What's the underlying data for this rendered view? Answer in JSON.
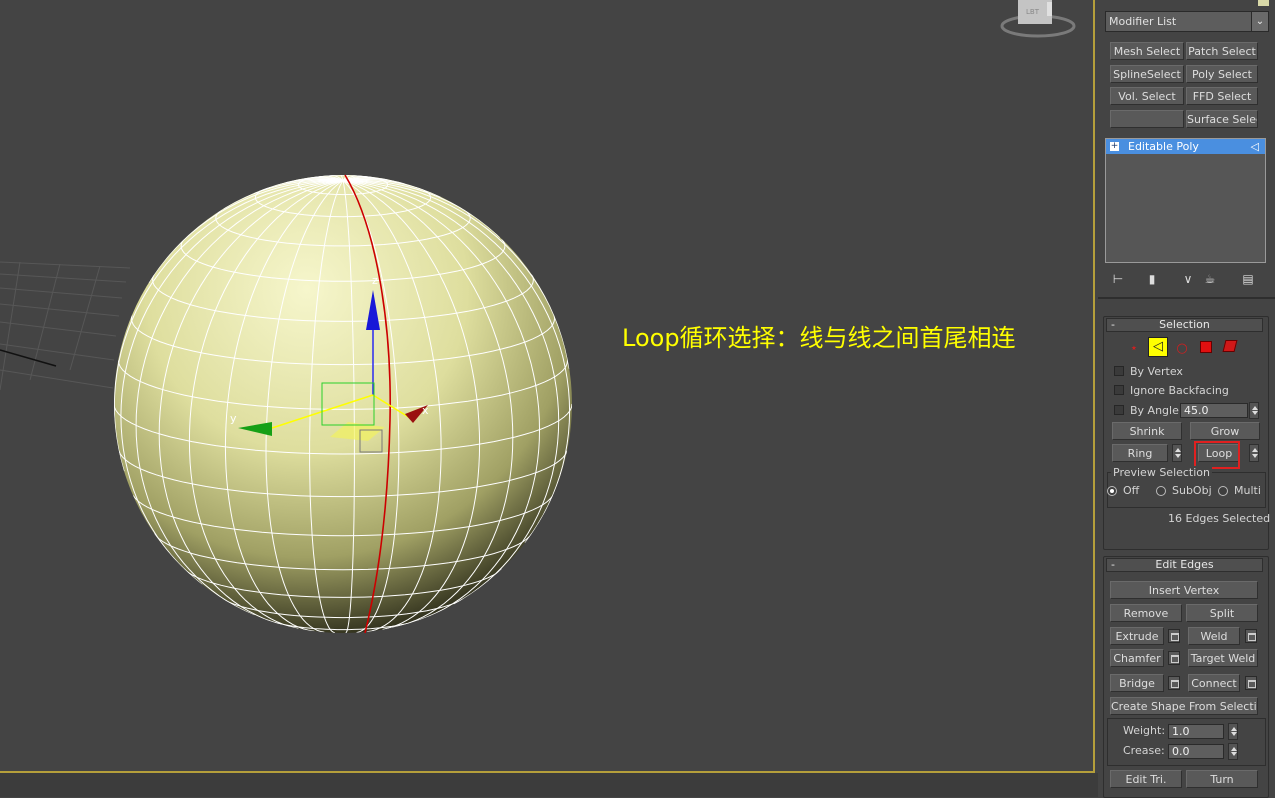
{
  "viewport": {
    "annotation": "Loop循环选择：线与线之间首尾相连",
    "gizmo_labels": {
      "z": "z",
      "y": "y",
      "x": "x"
    },
    "viewcube_label": "LBT"
  },
  "modifier_list": {
    "label": "Modifier List"
  },
  "modifier_buttons": [
    "Mesh Select",
    "Patch Select",
    "SplineSelect",
    "Poly Select",
    "Vol. Select",
    "FFD Select",
    "",
    "Surface Select"
  ],
  "stack": {
    "item": "Editable Poly"
  },
  "selection": {
    "title": "Selection",
    "by_vertex": "By Vertex",
    "ignore_backfacing": "Ignore Backfacing",
    "by_angle": "By Angle:",
    "angle_value": "45.0",
    "shrink": "Shrink",
    "grow": "Grow",
    "ring": "Ring",
    "loop": "Loop",
    "preview_title": "Preview Selection",
    "preview_off": "Off",
    "preview_subobj": "SubObj",
    "preview_multi": "Multi",
    "status": "16 Edges Selected"
  },
  "edit_edges": {
    "title": "Edit Edges",
    "insert_vertex": "Insert Vertex",
    "remove": "Remove",
    "split": "Split",
    "extrude": "Extrude",
    "weld": "Weld",
    "chamfer": "Chamfer",
    "target_weld": "Target Weld",
    "bridge": "Bridge",
    "connect": "Connect",
    "create_shape": "Create Shape From Selection",
    "weight_label": "Weight:",
    "weight_value": "1.0",
    "crease_label": "Crease:",
    "crease_value": "0.0",
    "edit_tri": "Edit Tri.",
    "turn": "Turn"
  },
  "colors": {
    "annotation": "#ffff00",
    "viewport_border": "#b59f3b",
    "highlight_box": "#e02020",
    "selected_edge": "#cc0000",
    "stack_selected": "#4a8fe0"
  }
}
